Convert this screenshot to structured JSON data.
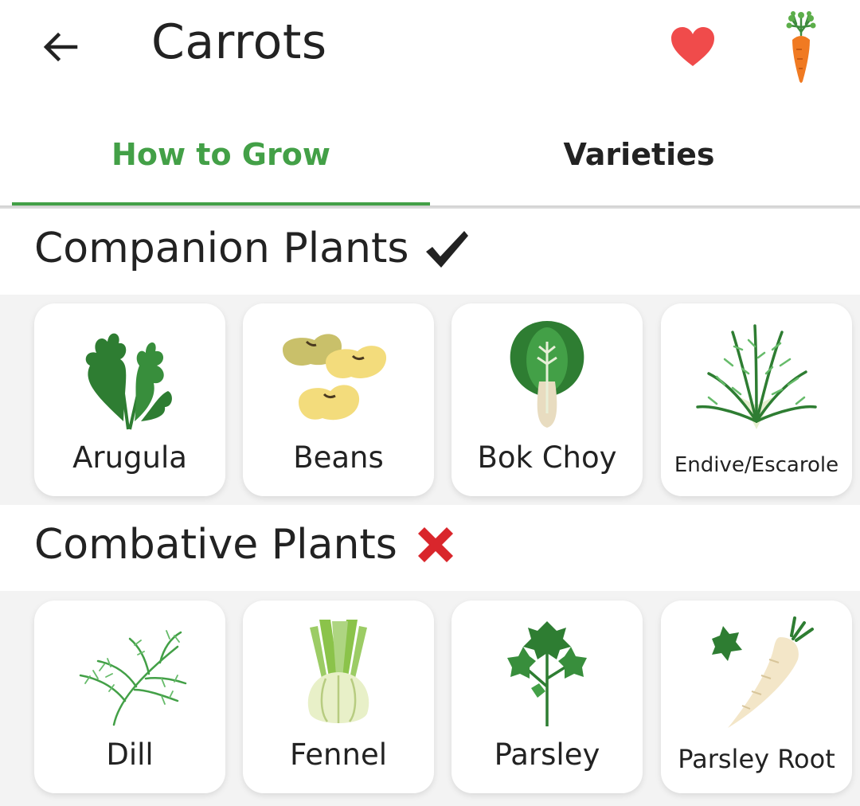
{
  "appbar": {
    "title": "Carrots",
    "back_icon": "arrow-back-icon",
    "favorite_icon": "heart-icon",
    "crop_icon": "carrot-icon",
    "favorite_color": "#f04b4b"
  },
  "tabs": [
    {
      "label": "How to Grow",
      "active": true
    },
    {
      "label": "Varieties",
      "active": false
    }
  ],
  "accent_color": "#43a047",
  "companion": {
    "title": "Companion Plants",
    "mark_icon": "check-mark-icon",
    "plants": [
      {
        "name": "Arugula",
        "icon": "arugula-icon"
      },
      {
        "name": "Beans",
        "icon": "beans-icon"
      },
      {
        "name": "Bok Choy",
        "icon": "bok-choy-icon"
      },
      {
        "name": "Endive/Escarole",
        "icon": "endive-icon"
      }
    ]
  },
  "combative": {
    "title": "Combative Plants",
    "mark_icon": "cross-mark-icon",
    "plants": [
      {
        "name": "Dill",
        "icon": "dill-icon"
      },
      {
        "name": "Fennel",
        "icon": "fennel-icon"
      },
      {
        "name": "Parsley",
        "icon": "parsley-icon"
      },
      {
        "name": "Parsley Root",
        "icon": "parsley-root-icon"
      }
    ]
  }
}
